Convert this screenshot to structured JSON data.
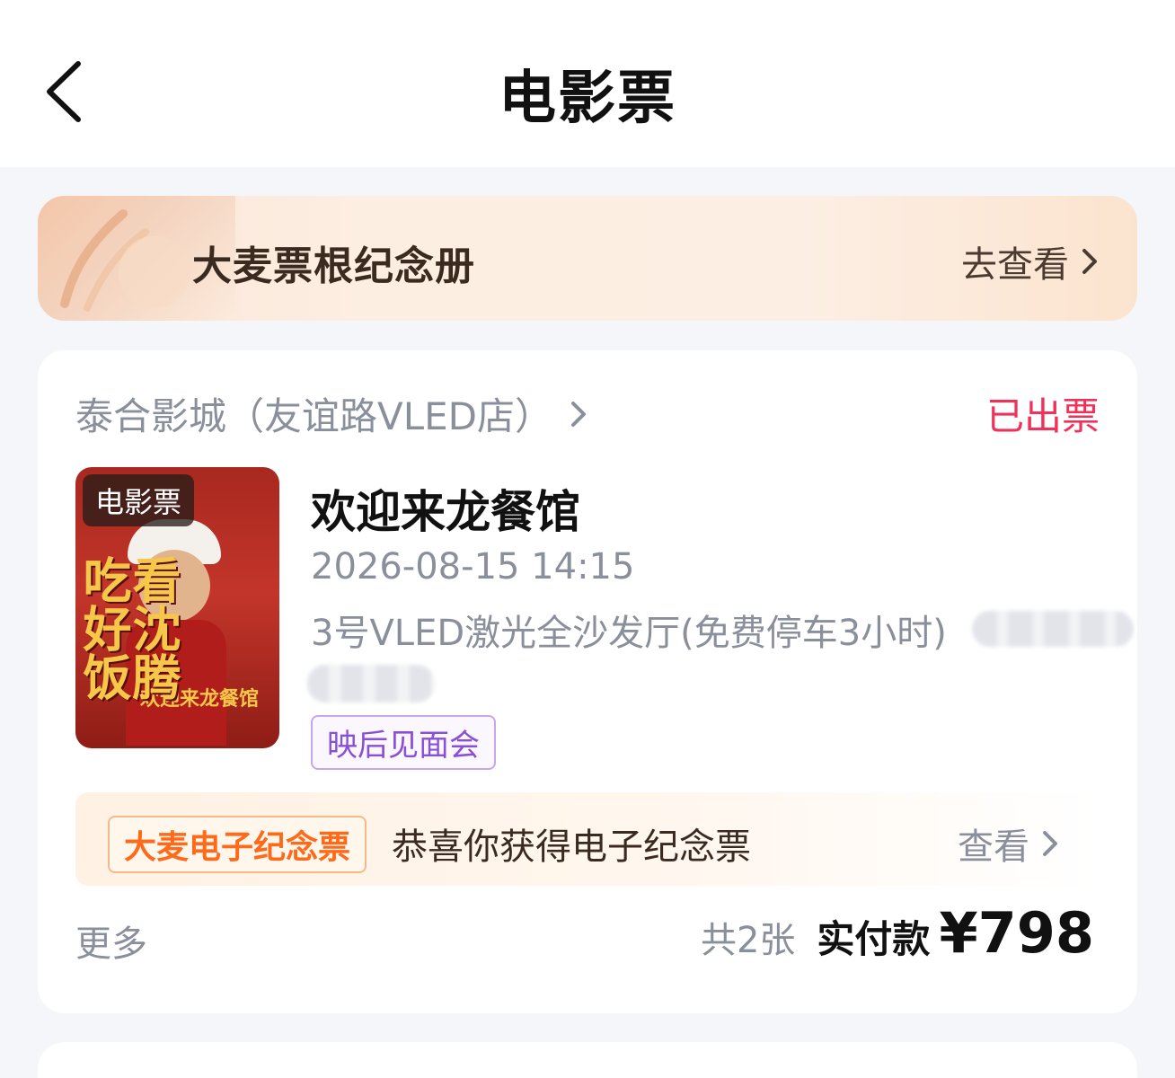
{
  "header": {
    "title": "电影票",
    "back_icon": "chevron-left-icon"
  },
  "album_banner": {
    "title": "大麦票根纪念册",
    "link_label": "去查看"
  },
  "order": {
    "cinema_name": "泰合影城（友谊路VLED店）",
    "status": "已出票",
    "status_color": "#f0315a",
    "poster": {
      "tag": "电影票",
      "left_text": "吃好饭",
      "right_text": "看沈腾",
      "apron_text": "欢迎来龙餐馆"
    },
    "movie_title": "欢迎来龙餐馆",
    "show_time": "2026-08-15 14:15",
    "hall": "3号VLED激光全沙发厅(免费停车3小时)",
    "tag": "映后见面会",
    "memorial": {
      "badge": "大麦电子纪念票",
      "message": "恭喜你获得电子纪念票",
      "link_label": "查看"
    },
    "more_label": "更多",
    "ticket_count": "共2张",
    "paid_label": "实付款",
    "paid_amount": "¥798"
  }
}
